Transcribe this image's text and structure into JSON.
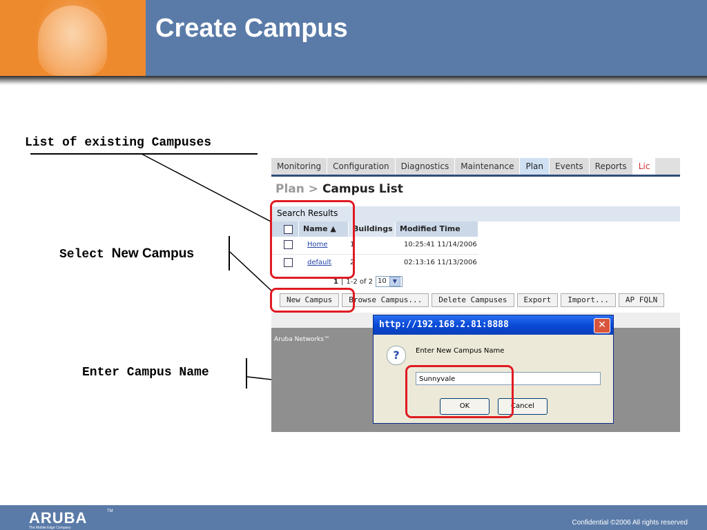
{
  "slide": {
    "title": "Create Campus"
  },
  "annotations": {
    "list_existing": "List of existing Campuses",
    "select_prefix": "Select",
    "select_target": "New Campus",
    "enter_name": "Enter Campus Name"
  },
  "app": {
    "tabs": [
      "Monitoring",
      "Configuration",
      "Diagnostics",
      "Maintenance",
      "Plan",
      "Events",
      "Reports",
      "Lic"
    ],
    "active_tab": "Plan",
    "breadcrumb": {
      "parent": "Plan >",
      "current": "Campus List"
    },
    "search_results_title": "Search Results",
    "table": {
      "headers": [
        "Name ▲",
        "Buildings",
        "Modified Time"
      ],
      "rows": [
        {
          "name": "Home",
          "buildings": "1",
          "modified": "10:25:41 11/14/2006"
        },
        {
          "name": "default",
          "buildings": "2",
          "modified": "02:13:16 11/13/2006"
        }
      ]
    },
    "pager": {
      "page": "1",
      "separator": "|",
      "range": "1-2 of 2",
      "per_page": "10"
    },
    "buttons": [
      "New Campus",
      "Browse Campus...",
      "Delete Campuses",
      "Export",
      "Import...",
      "AP FQLN"
    ],
    "footer_text": "Aruba Networks™"
  },
  "dialog": {
    "title": "http://192.168.2.81:8888",
    "prompt": "Enter New Campus Name",
    "input_value": "Sunnyvale",
    "ok_label": "OK",
    "cancel_label": "Cancel"
  },
  "footer": {
    "logo": "ARUBA",
    "logo_tm": "TM",
    "tagline": "The Mobile Edge Company",
    "confidential": "Confidential  ©2006 All rights reserved"
  },
  "colors": {
    "header_blue": "#5a7ba8",
    "highlight_red": "#e01a22",
    "accent_orange": "#f19a4a",
    "dialog_blue": "#0a4ad8"
  }
}
